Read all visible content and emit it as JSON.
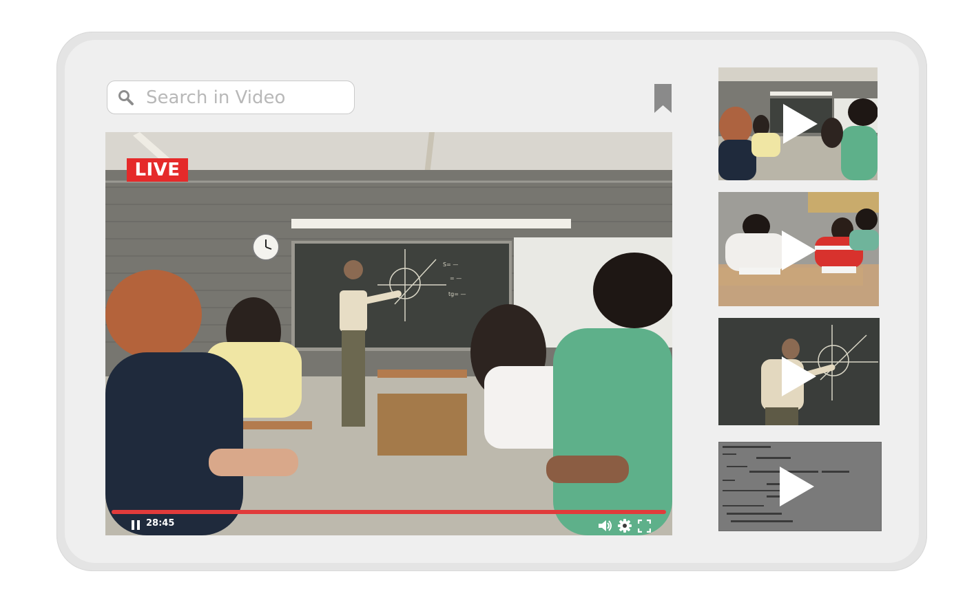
{
  "search": {
    "placeholder": "Search in Video"
  },
  "player": {
    "live_label": "LIVE",
    "time": "28:45",
    "progress": 1.0,
    "accent_color": "#e13b3b"
  },
  "icons": {
    "search": "search-icon",
    "bookmark": "bookmark-icon",
    "pause": "pause-icon",
    "volume": "volume-icon",
    "settings": "gear-icon",
    "fullscreen": "fullscreen-icon",
    "play": "play-icon"
  },
  "thumbnails": [
    {
      "scene": "classroom-wide"
    },
    {
      "scene": "students-writing"
    },
    {
      "scene": "teacher-chalkboard"
    },
    {
      "scene": "math-worksheet"
    }
  ]
}
